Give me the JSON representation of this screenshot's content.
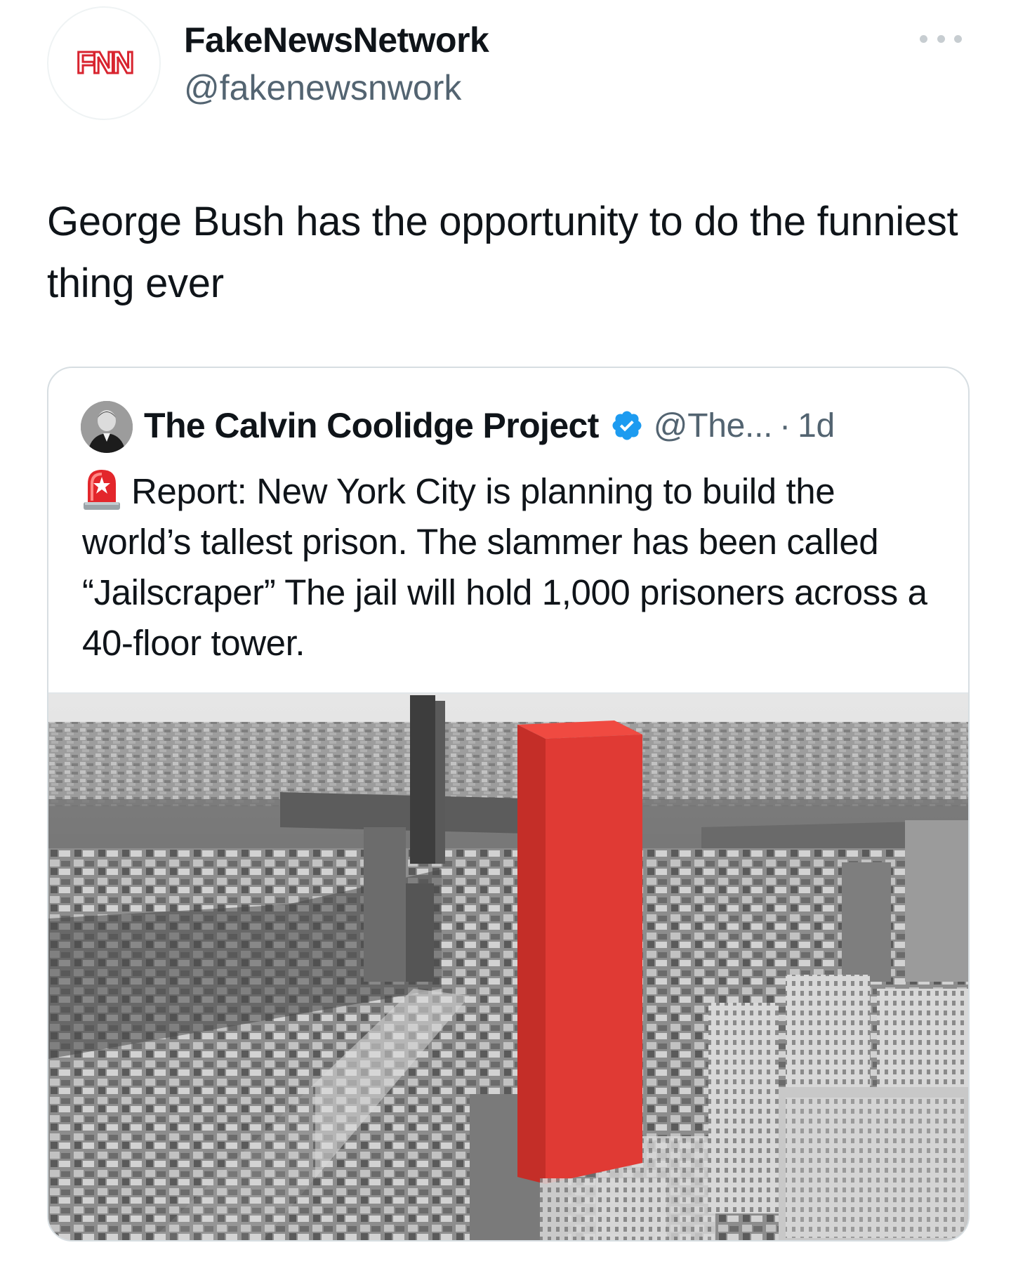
{
  "tweet": {
    "avatar_logo": "FNN",
    "display_name": "FakeNewsNetwork",
    "handle": "@fakenewsnwork",
    "more_icon": "more-horizontal-icon",
    "text": "George Bush has the opportunity to do the funniest thing ever"
  },
  "quoted_tweet": {
    "display_name": "The Calvin Coolidge Project",
    "verified": true,
    "verified_color": "#1d9bf0",
    "handle": "@The...",
    "separator": "·",
    "time": "1d",
    "emoji_icon": "police-siren-icon",
    "text": "Report: New York City is planning to build the world’s tallest prison. The slammer has been called “Jailscraper” The jail will hold 1,000 prisoners across a 40-floor tower.",
    "media": {
      "type": "photo",
      "highlight_color": "#e03a34"
    }
  }
}
